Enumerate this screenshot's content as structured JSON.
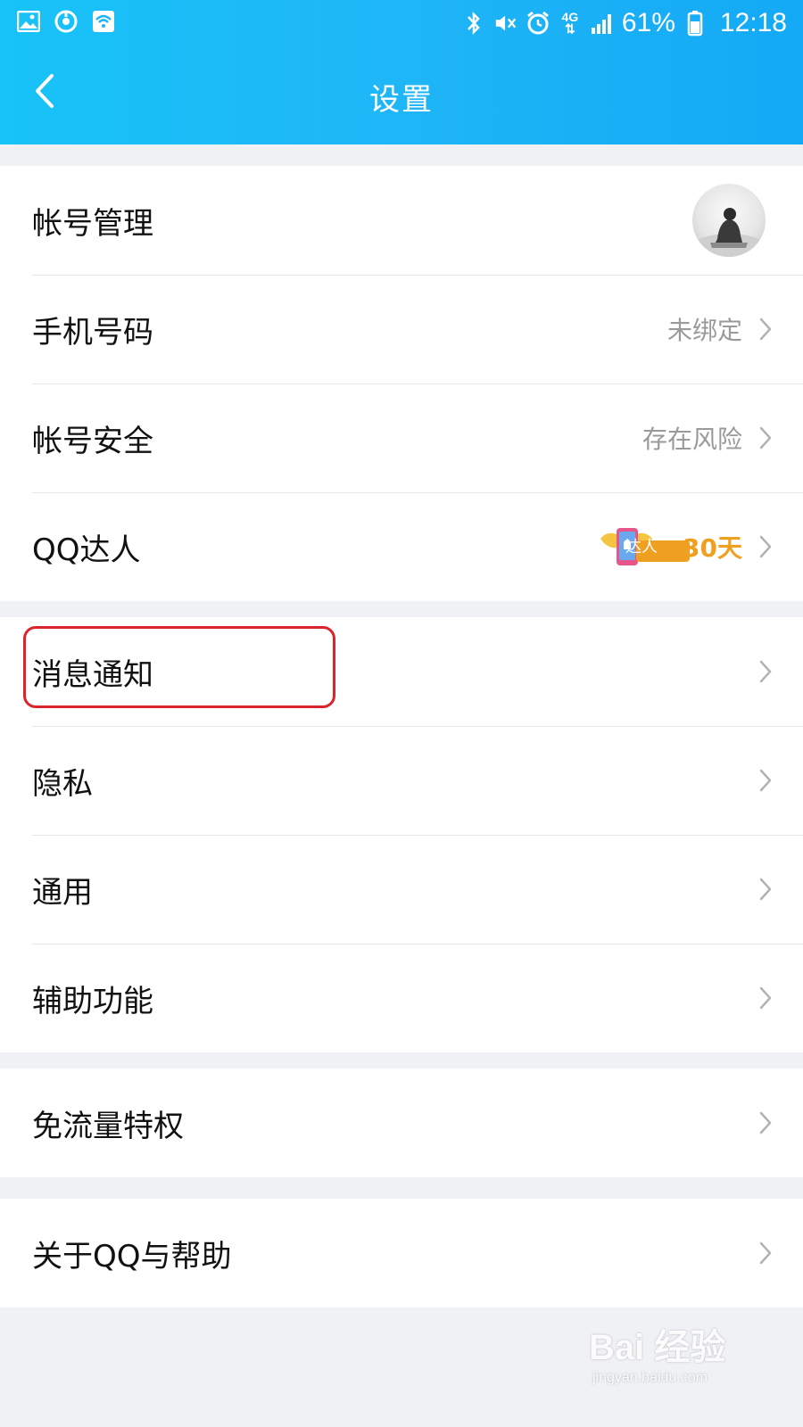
{
  "status_bar": {
    "battery_percent": "61%",
    "time": "12:18",
    "network": "4G",
    "left_icons": [
      "gallery-icon",
      "sync-icon",
      "wifi-app-icon"
    ],
    "right_icons": [
      "bluetooth-icon",
      "mute-icon",
      "alarm-icon",
      "signal-icon",
      "battery-icon"
    ]
  },
  "header": {
    "title": "设置",
    "back_icon": "chevron-left-icon",
    "color": "#1fb6f7"
  },
  "groups": [
    {
      "items": [
        {
          "label": "帐号管理",
          "value": "",
          "has_avatar": true
        },
        {
          "label": "手机号码",
          "value": "未绑定"
        },
        {
          "label": "帐号安全",
          "value": "存在风险"
        },
        {
          "label": "QQ达人",
          "badge_text": "达人",
          "value": "30天"
        }
      ]
    },
    {
      "items": [
        {
          "label": "消息通知",
          "highlighted": true
        },
        {
          "label": "隐私"
        },
        {
          "label": "通用"
        },
        {
          "label": "辅助功能"
        }
      ]
    },
    {
      "items": [
        {
          "label": "免流量特权"
        }
      ]
    },
    {
      "items": [
        {
          "label": "关于QQ与帮助"
        }
      ]
    }
  ],
  "highlight_color": "#d9252b",
  "watermark": {
    "main": "Bai 经验",
    "sub": "jingyan.baidu.com"
  }
}
